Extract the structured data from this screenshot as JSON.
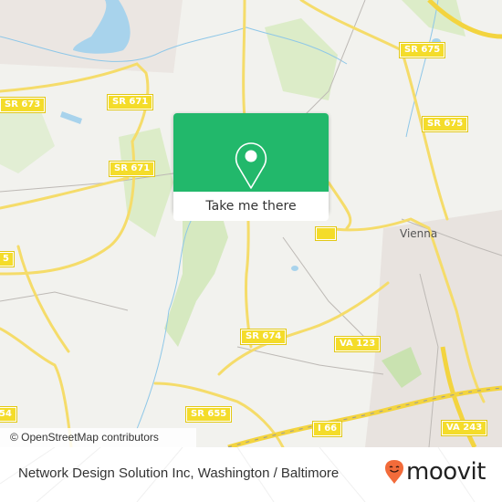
{
  "map": {
    "road_shields": [
      {
        "label": "SR 675"
      },
      {
        "label": "SR 671"
      },
      {
        "label": "SR 673"
      },
      {
        "label": "SR 675"
      },
      {
        "label": "SR 671"
      },
      {
        "label": "SR 674"
      },
      {
        "label": "VA 123"
      },
      {
        "label": "SR 655"
      },
      {
        "label": "I 66"
      },
      {
        "label": "VA 243"
      },
      {
        "label": "5"
      },
      {
        "label": "54"
      }
    ],
    "place_labels": [
      {
        "label": "Vienna"
      }
    ],
    "attribution": "© OpenStreetMap contributors",
    "colors": {
      "background": "#f2f2ee",
      "road": "#f5dc6a",
      "water": "#a8d3ec",
      "park": "#d6e9c0",
      "urban": "#e7e2de"
    }
  },
  "popup": {
    "icon": "location-pin-icon",
    "button_label": "Take me there",
    "accent_color": "#22b86b"
  },
  "footer": {
    "title": "Network Design Solution Inc, Washington / Baltimore",
    "brand": "moovit",
    "brand_icon": "moovit-smiley-pin-icon",
    "brand_color": "#f26b3a"
  }
}
